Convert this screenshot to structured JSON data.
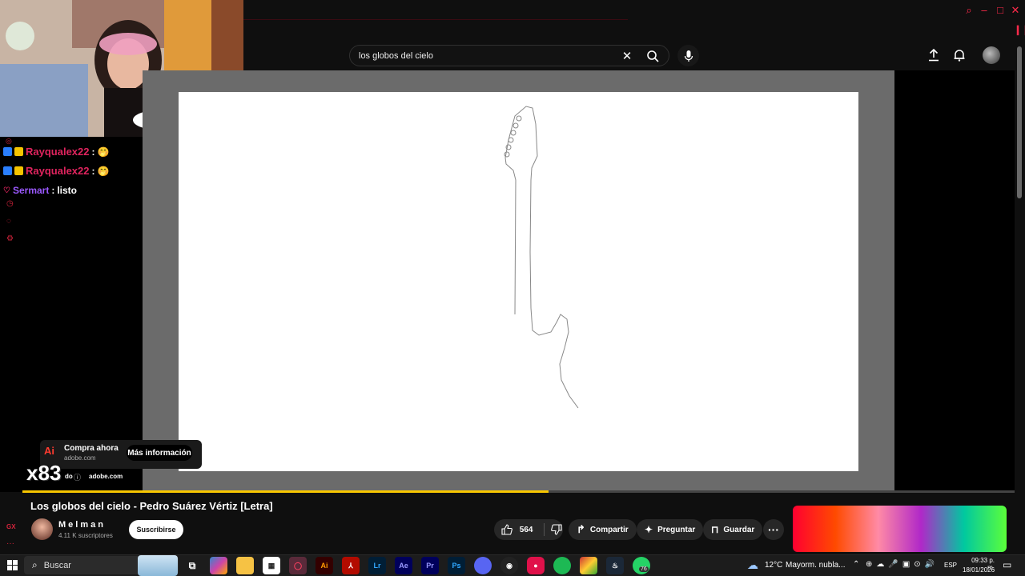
{
  "youtube": {
    "search_value": "los globos del cielo",
    "video_title": "Los globos del cielo - Pedro Suárez Vértiz [Letra]",
    "channel_name": "Melman",
    "subscribers": "4.11 K suscriptores",
    "subscribe_label": "Suscribirse",
    "likes": "564",
    "share_label": "Compartir",
    "ask_label": "Preguntar",
    "save_label": "Guardar",
    "progress_fraction": 0.53
  },
  "chat": {
    "messages": [
      {
        "user": "Rayqualex22",
        "sep": " :",
        "text": "🤭"
      },
      {
        "user": "Rayqualex22",
        "sep": " :",
        "text": "🤭"
      },
      {
        "user": "Sermart",
        "sep": " :",
        "text": " listo"
      }
    ]
  },
  "ad": {
    "logo": "Ai",
    "title": "Compra ahora",
    "domain": "adobe.com",
    "cta": "Más información",
    "footer_prefix": "do",
    "footer_domain": "adobe.com",
    "overlay_text": "x83"
  },
  "taskbar": {
    "search_label": "Buscar",
    "weather": "12°C",
    "weather_desc": "Mayorm. nubla...",
    "lang": "ESP",
    "time": "09:33 p. m.",
    "date": "18/01/2026",
    "badge_count": "76",
    "apps": [
      "Ai",
      "Lr",
      "Ae",
      "Pr",
      "Ps"
    ]
  },
  "colors": {
    "accent_red": "#ff0033",
    "progress": "#f7c600",
    "chat_user": "#e0245e",
    "chat_user2": "#9b59ff"
  }
}
